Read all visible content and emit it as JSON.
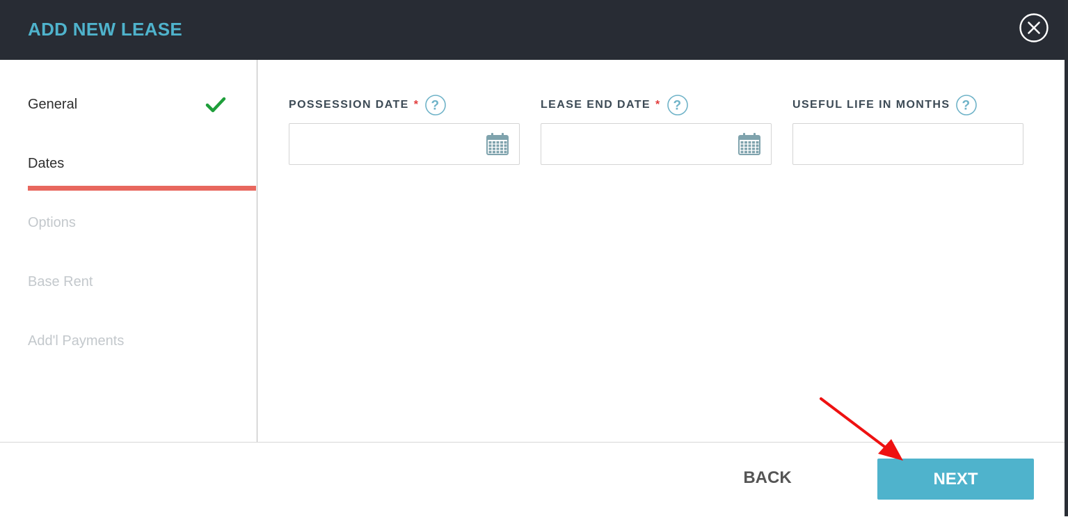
{
  "modal": {
    "title": "ADD NEW LEASE",
    "close_icon": "close-circle-icon"
  },
  "colors": {
    "header_bg": "#282c34",
    "title": "#4fb3cc",
    "active_step": "#2e2e2e",
    "inactive_step": "#c3c8cc",
    "step_underline": "#e8675e",
    "check": "#1e9e3a",
    "label": "#3c4a55",
    "required": "#e23b3b",
    "help_icon": "#6fb3c8",
    "calendar_icon": "#7fa3ad",
    "primary_button": "#4fb3cc",
    "back_button_text": "#555555",
    "annotation_arrow": "#ee1111"
  },
  "sidebar": {
    "steps": [
      {
        "label": "General",
        "state": "completed",
        "icon": "checkmark-icon"
      },
      {
        "label": "Dates",
        "state": "active"
      },
      {
        "label": "Options",
        "state": "disabled"
      },
      {
        "label": "Base Rent",
        "state": "disabled"
      },
      {
        "label": "Add'l Payments",
        "state": "disabled"
      }
    ]
  },
  "form": {
    "fields": [
      {
        "label": "POSSESSION DATE",
        "required": true,
        "required_mark": "*",
        "help_icon": "question-circle-icon",
        "value": "",
        "placeholder": "",
        "picker_icon": "calendar-icon"
      },
      {
        "label": "LEASE END DATE",
        "required": true,
        "required_mark": "*",
        "help_icon": "question-circle-icon",
        "value": "",
        "placeholder": "",
        "picker_icon": "calendar-icon"
      },
      {
        "label": "USEFUL LIFE IN MONTHS",
        "required": false,
        "help_icon": "question-circle-icon",
        "value": "",
        "placeholder": ""
      }
    ]
  },
  "footer": {
    "back_label": "BACK",
    "next_label": "NEXT"
  },
  "annotation": {
    "type": "arrow",
    "target": "next-button"
  }
}
